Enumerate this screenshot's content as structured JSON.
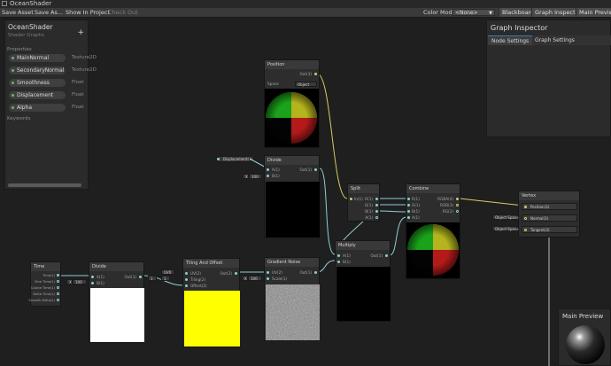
{
  "window": {
    "title": "OceanShader"
  },
  "toolbar": {
    "save_asset": "Save Asset",
    "save_as": "Save As...",
    "show_in_project": "Show In Project",
    "check_out": "Check Out",
    "color_mode_label": "Color Mode",
    "color_mode_value": "<None>",
    "blackboard": "Blackboard",
    "graph_inspector": "Graph Inspector",
    "main_preview": "Main Preview"
  },
  "blackboard": {
    "title": "OceanShader",
    "subtitle": "Shader Graphs",
    "add_label": "+",
    "properties_label": "Properties",
    "keywords_label": "Keywords",
    "properties": [
      {
        "name": "MainNormal",
        "type": "Texture2D"
      },
      {
        "name": "SecondaryNormal",
        "type": "Texture2D"
      },
      {
        "name": "Smoothness",
        "type": "Float"
      },
      {
        "name": "Displacement",
        "type": "Float"
      },
      {
        "name": "Alpha",
        "type": "Float"
      }
    ]
  },
  "inspector": {
    "title": "Graph Inspector",
    "tabs": [
      "Node Settings",
      "Graph Settings"
    ]
  },
  "main_preview": {
    "title": "Main Preview"
  },
  "nodes": {
    "position": {
      "title": "Position",
      "out": "Out(3)",
      "space_label": "Space",
      "space_value": "Object"
    },
    "divide_top": {
      "title": "Divide",
      "a": "A(1)",
      "b": "B(1)",
      "out": "Out(1)",
      "b_value": "100",
      "b_axis": "X"
    },
    "displacement_prop": {
      "label": "Displacement(1)"
    },
    "split": {
      "title": "Split",
      "in": "In(1)",
      "r": "R(1)",
      "g": "G(1)",
      "b": "B(1)",
      "a": "A(1)"
    },
    "combine": {
      "title": "Combine",
      "r": "R(1)",
      "g": "G(1)",
      "b": "B(1)",
      "a": "A(1)",
      "rgba": "RGBA(4)",
      "rgb": "RGB(3)",
      "rg": "RG(2)"
    },
    "vertex": {
      "title": "Vertex",
      "position": "Position(3)",
      "normal": "Normal(3)",
      "tangent": "Tangent(3)",
      "space": "Object Space"
    },
    "multiply": {
      "title": "Multiply",
      "a": "A(1)",
      "b": "B(1)",
      "out": "Out(1)"
    },
    "time": {
      "title": "Time",
      "ports": [
        "Time(1)",
        "Sine Time(1)",
        "Cosine Time(1)",
        "Delta Time(1)",
        "Smooth Delta(1)"
      ]
    },
    "divide_bottom": {
      "title": "Divide",
      "a": "A(1)",
      "b": "B(1)",
      "out": "Out(1)",
      "b_value": "100",
      "b_axis": "X"
    },
    "tiling": {
      "title": "Tiling And Offset",
      "uv": "UV(2)",
      "tiling": "Tiling(2)",
      "offset": "Offset(2)",
      "out": "Out(2)",
      "uv_value": "UV0",
      "tiling_x": "1",
      "tiling_y": "1"
    },
    "gradient_noise": {
      "title": "Gradient Noise",
      "uv": "UV(2)",
      "scale": "Scale(1)",
      "out": "Out(1)",
      "scale_value": "100"
    }
  }
}
